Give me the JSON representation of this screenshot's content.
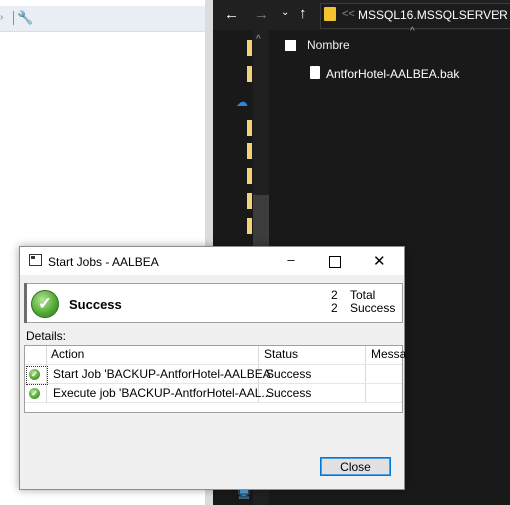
{
  "explorer": {
    "address_sep": "<<",
    "address_path": "MSSQL16.MSSQLSERVER",
    "column_name": "Nombre",
    "files": [
      {
        "name": "AntforHotel-AALBEA.bak"
      }
    ]
  },
  "dialog": {
    "title": "Start Jobs - AALBEA",
    "summary": {
      "status": "Success",
      "total_count": "2",
      "total_label": "Total",
      "success_count": "2",
      "success_label": "Success"
    },
    "details_label": "Details:",
    "columns": [
      "Action",
      "Status",
      "Messa"
    ],
    "rows": [
      {
        "action": "Start Job 'BACKUP-AntforHotel-AALBEA'",
        "status": "Success",
        "message": ""
      },
      {
        "action": "Execute job 'BACKUP-AntforHotel-AAL...",
        "status": "Success",
        "message": ""
      }
    ],
    "close_label": "Close"
  }
}
